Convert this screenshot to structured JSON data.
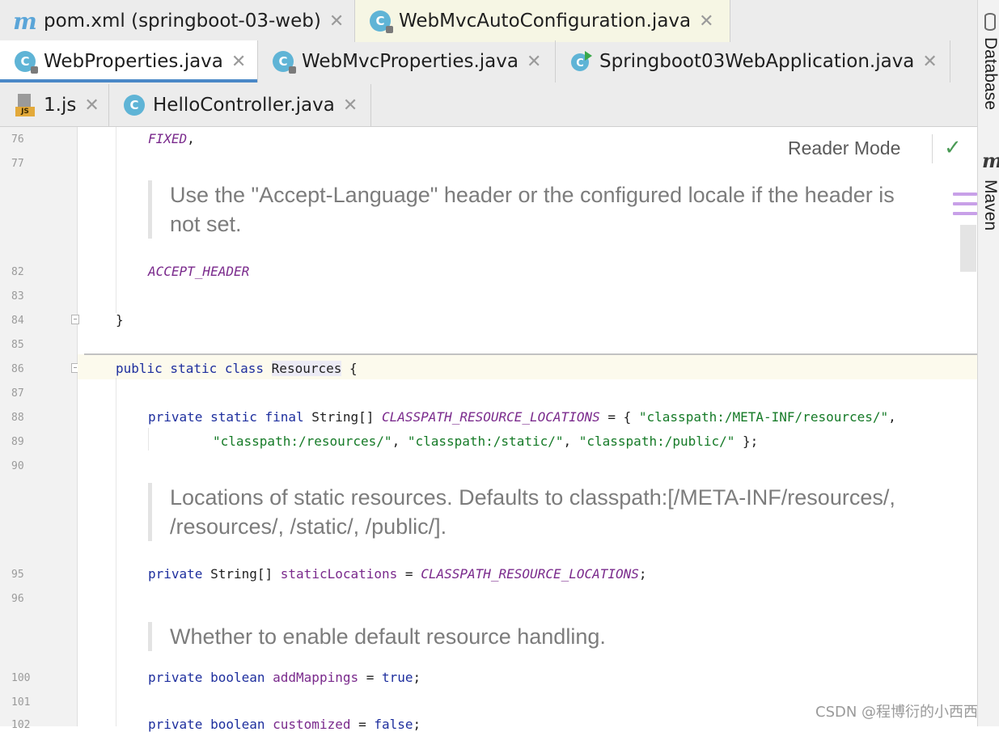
{
  "tabs": {
    "row1": [
      {
        "label": "pom.xml (springboot-03-web)",
        "icon": "maven-icon"
      },
      {
        "label": "WebMvcAutoConfiguration.java",
        "icon": "class-icon"
      }
    ],
    "row2": [
      {
        "label": "WebProperties.java",
        "icon": "class-icon"
      },
      {
        "label": "WebMvcProperties.java",
        "icon": "class-icon"
      },
      {
        "label": "Springboot03WebApplication.java",
        "icon": "spring-app-icon"
      }
    ],
    "row3": [
      {
        "label": "1.js",
        "icon": "js-file-icon"
      },
      {
        "label": "HelloController.java",
        "icon": "class-icon"
      }
    ],
    "close_glyph": "✕"
  },
  "gutter": {
    "line_numbers": [
      "76",
      "77",
      "82",
      "83",
      "84",
      "85",
      "86",
      "87",
      "88",
      "89",
      "90",
      "95",
      "96",
      "100",
      "101",
      "102"
    ]
  },
  "code": {
    "line76": "FIXED",
    "line76_punct": ",",
    "doc1": "Use the \"Accept-Language\" header or the configured locale if the header is not set.",
    "line82": "ACCEPT_HEADER",
    "line84": "}",
    "line86": {
      "kw": "public static class",
      "name": "Resources",
      "brace": "{"
    },
    "line88": {
      "kw": "private static final",
      "type": "String[]",
      "const": "CLASSPATH_RESOURCE_LOCATIONS",
      "op": " = {",
      "str1": "\"classpath:/META-INF/resources/\"",
      "comma": ","
    },
    "line89": {
      "str2": "\"classpath:/resources/\"",
      "str3": "\"classpath:/static/\"",
      "str4": "\"classpath:/public/\"",
      "sep": ", ",
      "end": " };"
    },
    "doc2": "Locations of static resources. Defaults to classpath:[/META-INF/resources/, /resources/, /static/, /public/].",
    "line95": {
      "kw": "private",
      "type": "String[]",
      "field": "staticLocations",
      "op": " = ",
      "const": "CLASSPATH_RESOURCE_LOCATIONS",
      "end": ";"
    },
    "doc3": "Whether to enable default resource handling.",
    "line100": {
      "kw": "private boolean",
      "field": "addMappings",
      "op": " = ",
      "val": "true",
      "end": ";"
    },
    "line102": {
      "kw": "private boolean",
      "field": "customized",
      "op": " = ",
      "val": "false",
      "end": ";"
    }
  },
  "reader_mode": {
    "label": "Reader Mode",
    "status_icon": "check-icon"
  },
  "right_toolbar": [
    {
      "label": "Database",
      "icon": "database-icon"
    },
    {
      "label": "Maven",
      "icon": "maven-icon"
    }
  ],
  "watermark": "CSDN @程博衍的小西西",
  "colors": {
    "keyword": "#1e2f9e",
    "constant": "#7a2a8c",
    "string": "#157a27",
    "doc_text": "#7c7c7c",
    "active_tab_underline": "#4a88c7"
  }
}
